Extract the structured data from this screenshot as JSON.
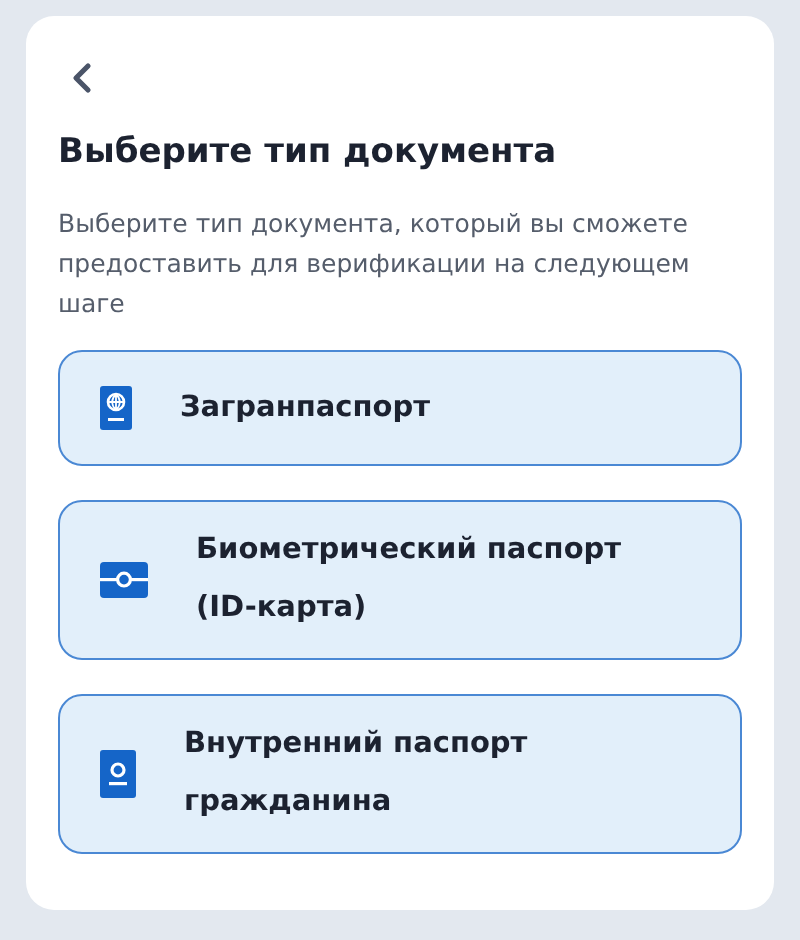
{
  "title": "Выберите тип документа",
  "description": "Выберите тип документа, который вы сможете предоставить для верификации на следующем шаге",
  "options": [
    {
      "kind": "passport",
      "label": "Загранпаспорт"
    },
    {
      "kind": "id_card",
      "label": "Биометрический паспорт (ID-карта)"
    },
    {
      "kind": "internal",
      "label": "Внутренний паспорт гражданина"
    }
  ]
}
